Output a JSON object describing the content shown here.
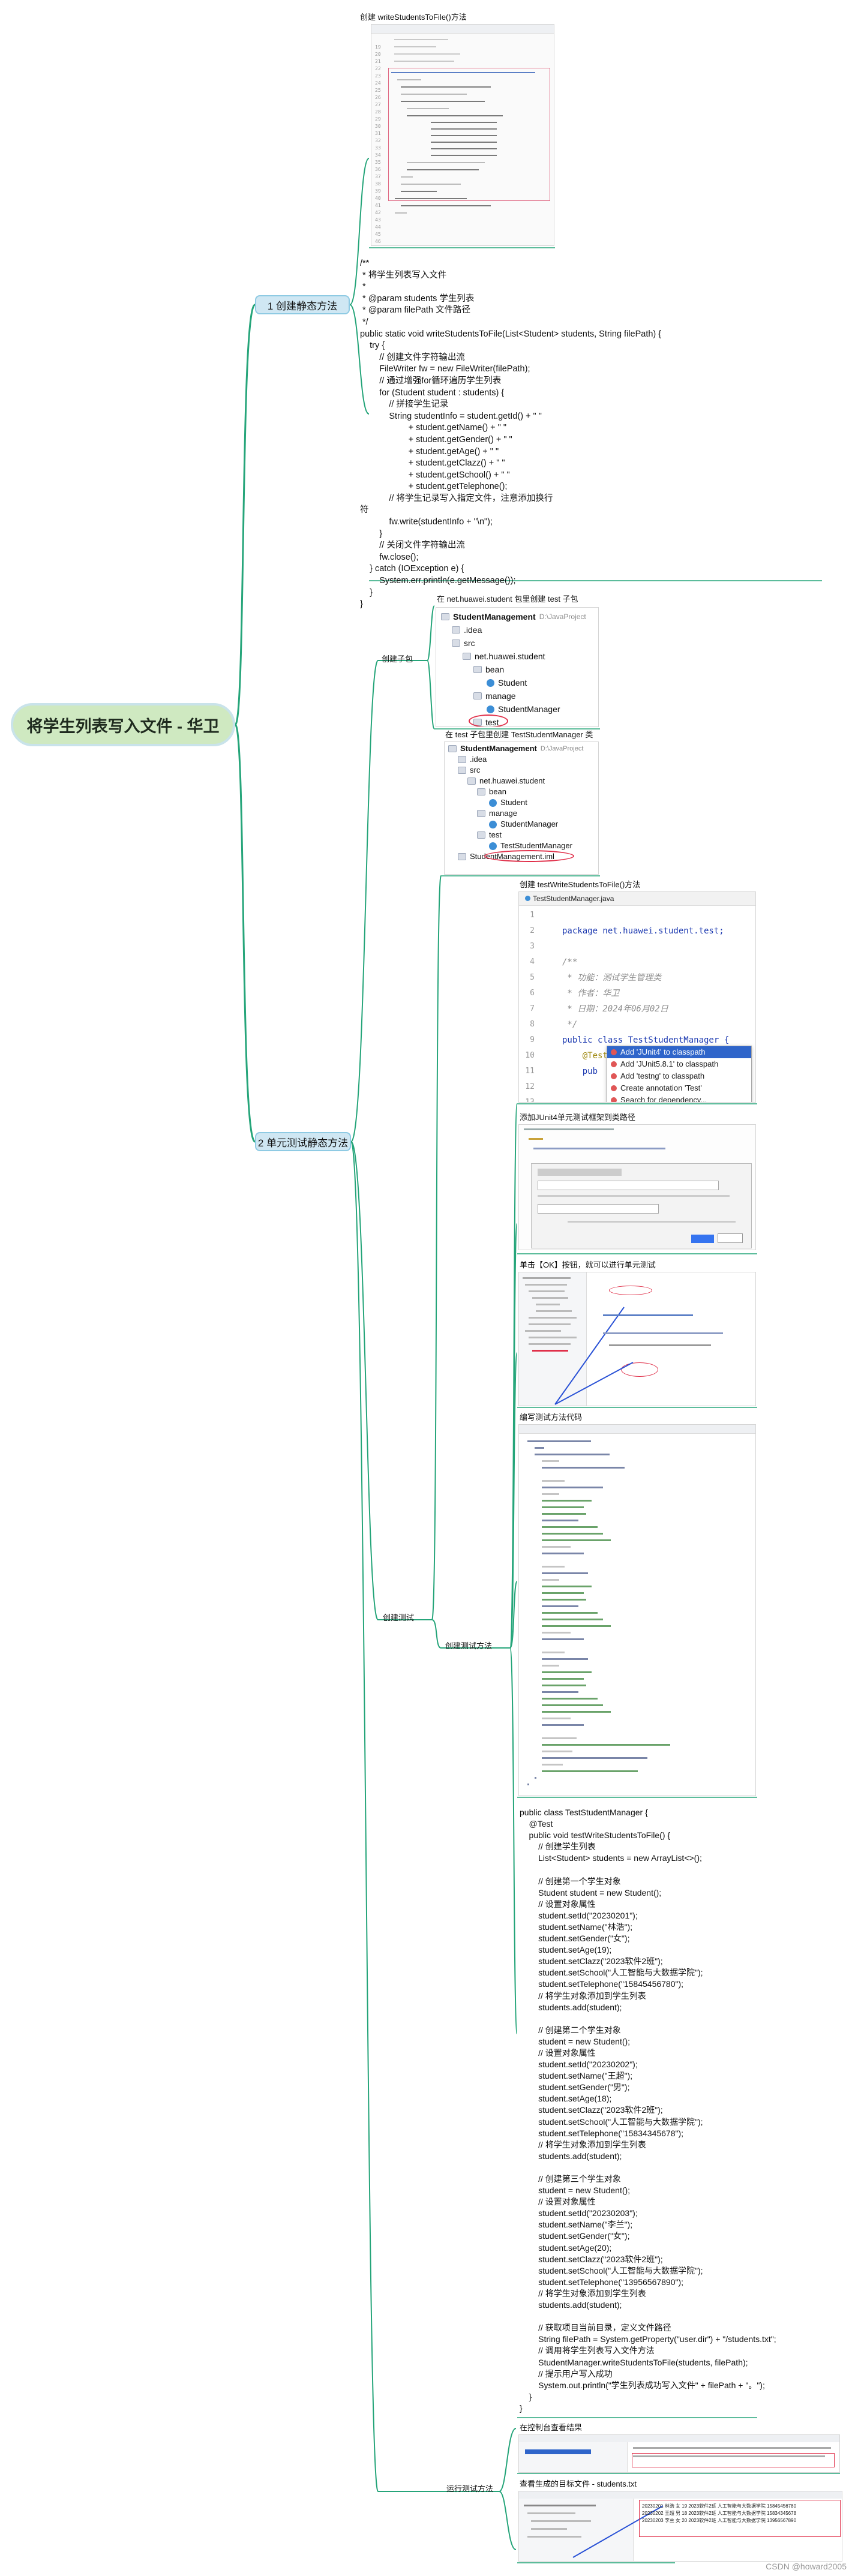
{
  "root": {
    "title": "将学生列表写入文件 - 华卫"
  },
  "branch1": {
    "label": "1 创建静态方法",
    "screenshot_caption": "创建 writeStudentsToFile()方法",
    "code_lines": [
      "/**",
      " * 将学生列表写入文件",
      " *",
      " * @param students 学生列表",
      " * @param filePath 文件路径",
      " */",
      "public static void writeStudentsToFile(List<Student> students, String filePath) {",
      "    try {",
      "        // 创建文件字符输出流",
      "        FileWriter fw = new FileWriter(filePath);",
      "        // 通过增强for循环遍历学生列表",
      "        for (Student student : students) {",
      "            // 拼接学生记录",
      "            String studentInfo = student.getId() + \" \"",
      "                    + student.getName() + \" \"",
      "                    + student.getGender() + \" \"",
      "                    + student.getAge() + \" \"",
      "                    + student.getClazz() + \" \"",
      "                    + student.getSchool() + \" \"",
      "                    + student.getTelephone();",
      "            // 将学生记录写入指定文件，注意添加换行",
      "符",
      "            fw.write(studentInfo + \"\\n\");",
      "        }",
      "        // 关闭文件字符输出流",
      "        fw.close();",
      "    } catch (IOException e) {",
      "        System.err.println(e.getMessage());",
      "    }",
      "}"
    ]
  },
  "branch2": {
    "label": "2 单元测试静态方法",
    "create_package": {
      "label": "创建子包",
      "caption": "在 net.huawei.student 包里创建 test 子包",
      "tree": [
        "StudentManagement",
        "D:\\JavaProject",
        ".idea",
        "src",
        "net.huawei.student",
        "bean",
        "Student",
        "manage",
        "StudentManager",
        "test"
      ]
    },
    "create_test": {
      "label": "创建测试",
      "class_caption": "在 test 子包里创建 TestStudentManager 类",
      "class_tree": [
        "StudentManagement",
        "D:\\JavaProject",
        ".idea",
        "src",
        "net.huawei.student",
        "bean",
        "Student",
        "manage",
        "StudentManager",
        "test",
        "TestStudentManager",
        "StudentManagement.iml"
      ],
      "method_caption": "创建 testWriteStudentsToFile()方法",
      "editor_tab": "TestStudentManager.java",
      "editor_lines": [
        "package net.huawei.student.test;",
        "",
        "/**",
        " * 功能：测试学生管理类",
        " * 作者：华卫",
        " * 日期：2024年06月02日",
        " */",
        "public class TestStudentManager {",
        "    @Test",
        "    pub",
        "",
        "",
        "}"
      ],
      "popup_items": [
        "Add 'JUnit4' to classpath",
        "Add 'JUnit5.8.1' to classpath",
        "Add 'testng' to classpath",
        "Create annotation 'Test'",
        "Search for dependency..."
      ],
      "junit_caption": "添加JUnit4单元测试框架到类路径",
      "ok_caption": "单击【OK】按钮，就可以进行单元测试",
      "test_code_caption": "编写测试方法代码",
      "test_code_label": "创建测试方法",
      "test_code_lines": [
        "public class TestStudentManager {",
        "    @Test",
        "    public void testWriteStudentsToFile() {",
        "        // 创建学生列表",
        "        List<Student> students = new ArrayList<>();",
        "",
        "        // 创建第一个学生对象",
        "        Student student = new Student();",
        "        // 设置对象属性",
        "        student.setId(\"20230201\");",
        "        student.setName(\"林浩\");",
        "        student.setGender(\"女\");",
        "        student.setAge(19);",
        "        student.setClazz(\"2023软件2班\");",
        "        student.setSchool(\"人工智能与大数据学院\");",
        "        student.setTelephone(\"15845456780\");",
        "        // 将学生对象添加到学生列表",
        "        students.add(student);",
        "",
        "        // 创建第二个学生对象",
        "        student = new Student();",
        "        // 设置对象属性",
        "        student.setId(\"20230202\");",
        "        student.setName(\"王超\");",
        "        student.setGender(\"男\");",
        "        student.setAge(18);",
        "        student.setClazz(\"2023软件2班\");",
        "        student.setSchool(\"人工智能与大数据学院\");",
        "        student.setTelephone(\"15834345678\");",
        "        // 将学生对象添加到学生列表",
        "        students.add(student);",
        "",
        "        // 创建第三个学生对象",
        "        student = new Student();",
        "        // 设置对象属性",
        "        student.setId(\"20230203\");",
        "        student.setName(\"李兰\");",
        "        student.setGender(\"女\");",
        "        student.setAge(20);",
        "        student.setClazz(\"2023软件2班\");",
        "        student.setSchool(\"人工智能与大数据学院\");",
        "        student.setTelephone(\"13956567890\");",
        "        // 将学生对象添加到学生列表",
        "        students.add(student);",
        "",
        "        // 获取项目当前目录，定义文件路径",
        "        String filePath = System.getProperty(\"user.dir\") + \"/students.txt\";",
        "        // 调用将学生列表写入文件方法",
        "        StudentManager.writeStudentsToFile(students, filePath);",
        "        // 提示用户写入成功",
        "        System.out.println(\"学生列表成功写入文件\" + filePath + \"。\");",
        "    }",
        "}"
      ]
    },
    "run_test": {
      "label": "运行测试方法",
      "console_caption": "在控制台查看结果",
      "file_caption": "查看生成的目标文件 - students.txt",
      "file_lines": [
        "20230201 林浩 女 19 2023软件2班 人工智能与大数据学院 15845456780",
        "20230202 王超 男 18 2023软件2班 人工智能与大数据学院 15834345678",
        "20230203 李兰 女 20 2023软件2班 人工智能与大数据学院 13956567890"
      ]
    }
  },
  "watermark": "CSDN @howard2005",
  "colors": {
    "link": "#26a57a",
    "root_fill": "#cfe9c1",
    "pill_fill": "#cfe7f3",
    "pill_border": "#8ecae3"
  }
}
